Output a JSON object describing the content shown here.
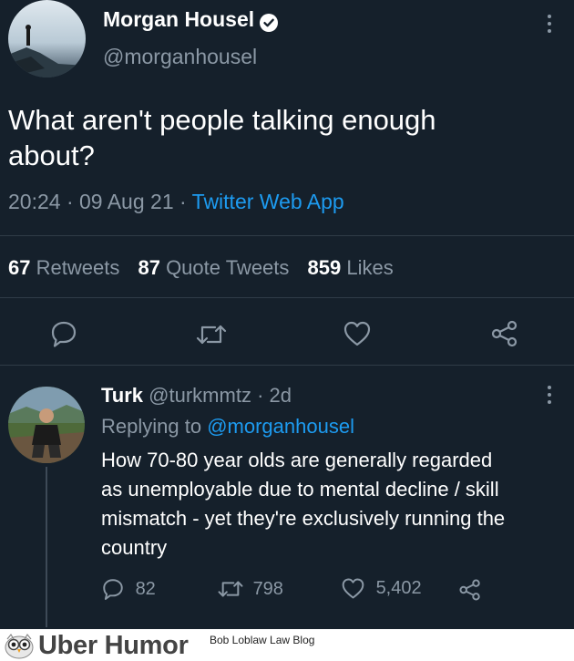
{
  "tweet": {
    "author_name": "Morgan Housel",
    "author_handle": "@morganhousel",
    "text_line1": "What aren't people talking enough",
    "text_line2": "about?",
    "time": "20:24",
    "sep1": "·",
    "date": "09 Aug 21",
    "sep2": "·",
    "source": "Twitter Web App",
    "stats": {
      "retweets_count": "67",
      "retweets_label": "Retweets",
      "quotes_count": "87",
      "quotes_label": "Quote Tweets",
      "likes_count": "859",
      "likes_label": "Likes"
    }
  },
  "reply": {
    "author_name": "Turk",
    "author_handle": "@turkmmtz",
    "age": "· 2d",
    "replying_prefix": "Replying to",
    "replying_handle": "@morganhousel",
    "lines": [
      "How 70-80 year olds are generally regarded",
      "as unemployable due to mental decline / skill",
      "mismatch - yet they're exclusively running the",
      "country"
    ],
    "replies": "82",
    "retweets": "798",
    "likes": "5,402"
  },
  "footer": {
    "brand": "Uber Humor",
    "caption": "Bob Loblaw Law Blog"
  },
  "colors": {
    "background": "#15202b",
    "link": "#1d9bf0",
    "muted": "#8b98a5"
  }
}
